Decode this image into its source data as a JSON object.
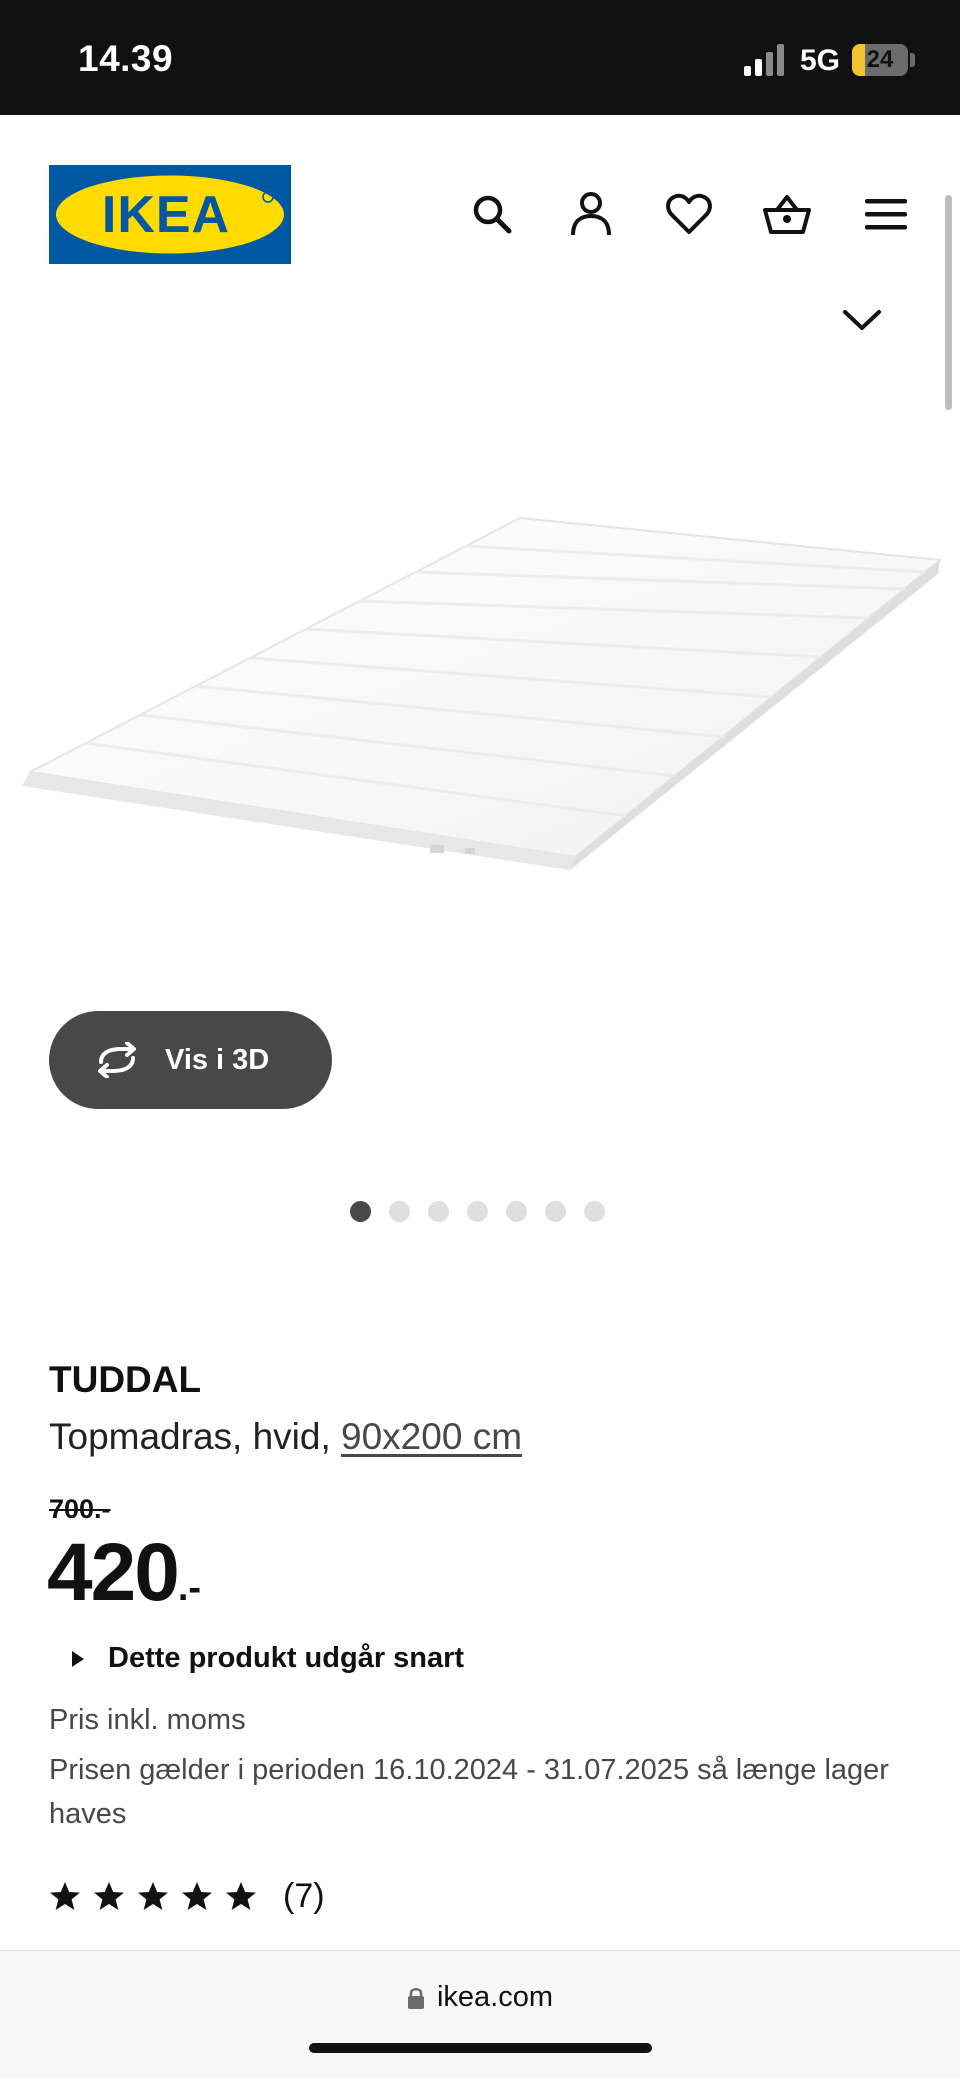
{
  "status_bar": {
    "time": "14.39",
    "network": "5G",
    "battery_level": "24",
    "battery_fraction": 0.24
  },
  "header": {
    "logo_text": "IKEA",
    "icons": [
      "search-icon",
      "profile-icon",
      "heart-icon",
      "basket-icon",
      "menu-icon"
    ]
  },
  "gallery": {
    "view_3d_label": "Vis i 3D",
    "dot_count": 7,
    "active_index": 0
  },
  "product": {
    "name": "TUDDAL",
    "description": "Topmadras, hvid, ",
    "size": "90x200 cm",
    "old_price": "700.-",
    "price": "420",
    "price_suffix": ".-",
    "discontinued_label": "Dette produkt udgår snart",
    "vat_note": "Pris inkl. moms",
    "period_note": "Prisen gælder i perioden 16.10.2024 - 31.07.2025 så længe lager haves",
    "rating_stars": 5,
    "rating_count": "(7)"
  },
  "browser": {
    "url": "ikea.com"
  },
  "colors": {
    "ikea_blue": "#0058a3",
    "ikea_yellow": "#ffdb00",
    "button_dark": "#484848"
  }
}
